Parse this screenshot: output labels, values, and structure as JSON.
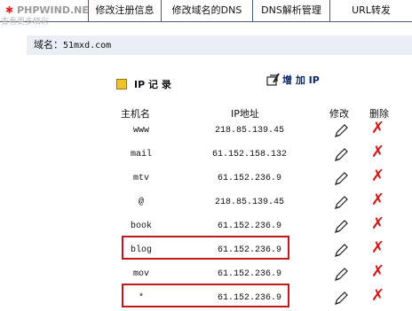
{
  "brand": {
    "star": "✱",
    "text": "PHPWIND.NET"
  },
  "watermark": "查看更多精彩",
  "tabs": [
    "修改注册信息",
    "修改域名的DNS",
    "DNS解析管理",
    "URL转发"
  ],
  "domain": {
    "label": "域名：",
    "value": "51mxd.com"
  },
  "record_title": "IP 记 录",
  "add_ip": "增 加 IP",
  "columns": {
    "host": "主机名",
    "ip": "IP地址",
    "edit": "修改",
    "delete": "删除"
  },
  "records": [
    {
      "host": "www",
      "ip": "218.85.139.45"
    },
    {
      "host": "mail",
      "ip": "61.152.158.132"
    },
    {
      "host": "mtv",
      "ip": "61.152.236.9"
    },
    {
      "host": "@",
      "ip": "218.85.139.45"
    },
    {
      "host": "book",
      "ip": "61.152.236.9"
    },
    {
      "host": "blog",
      "ip": "61.152.236.9"
    },
    {
      "host": "mov",
      "ip": "61.152.236.9"
    },
    {
      "host": "*",
      "ip": "61.152.236.9"
    }
  ],
  "highlighted_hosts": [
    "blog",
    "*"
  ],
  "colors": {
    "highlight": "#c0181c",
    "delete": "#d21a1a",
    "domain_bar": "#e9eef7",
    "square": "#f2c12e"
  }
}
